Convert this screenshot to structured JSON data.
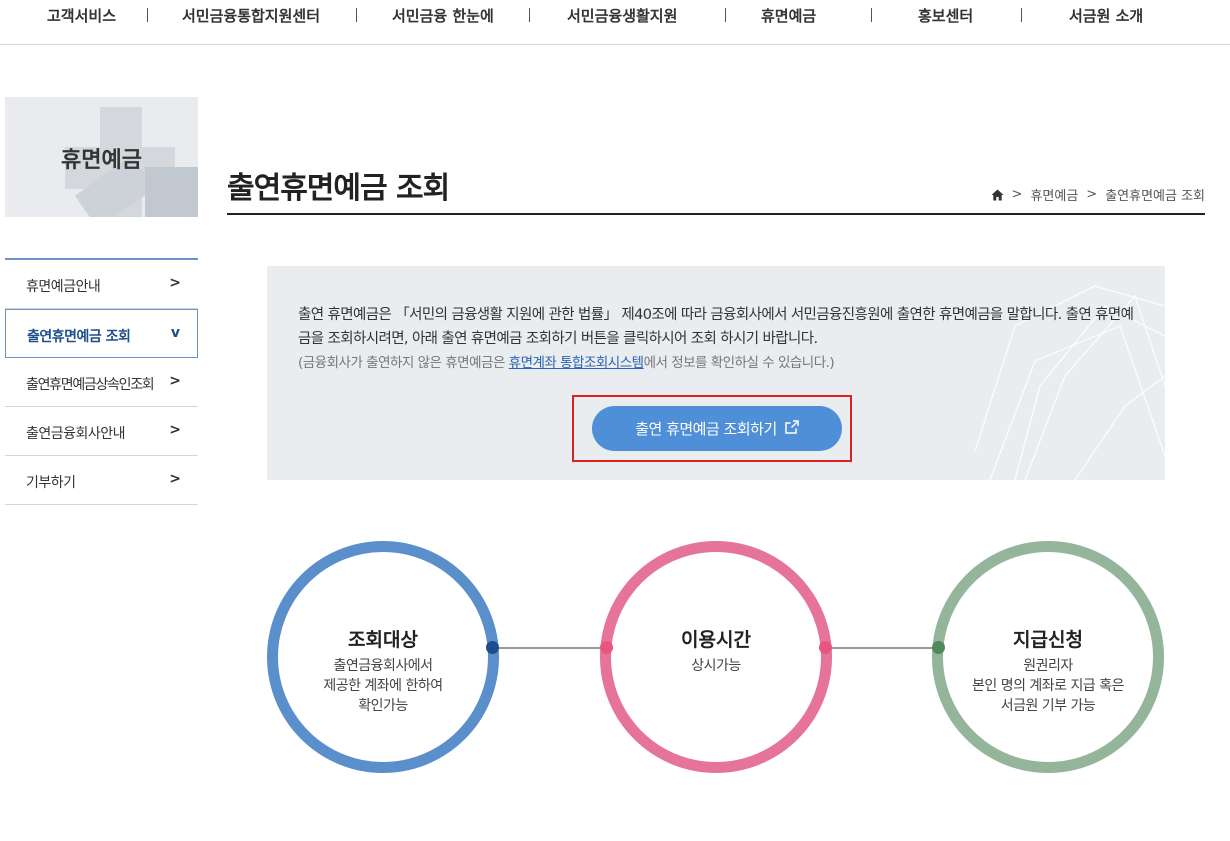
{
  "topnav": {
    "items": [
      "고객서비스",
      "서민금융통합지원센터",
      "서민금융 한눈에",
      "서민금융생활지원",
      "휴면예금",
      "홍보센터",
      "서금원 소개"
    ]
  },
  "sidebar": {
    "title": "휴면예금",
    "items": [
      {
        "label": "휴면예금안내",
        "arrow": ">"
      },
      {
        "label": "출연휴면예금 조회",
        "arrow": "v"
      },
      {
        "label": "출연휴면예금상속인조회",
        "arrow": ">"
      },
      {
        "label": "출연금융회사안내",
        "arrow": ">"
      },
      {
        "label": "기부하기",
        "arrow": ">"
      }
    ]
  },
  "page": {
    "title": "출연휴면예금 조회",
    "breadcrumb": [
      ">",
      "휴면예금",
      ">",
      "출연휴면예금 조회"
    ]
  },
  "info": {
    "text": "출연 휴면예금은 「서민의 금융생활 지원에 관한 법률」 제40조에 따라 금융회사에서 서민금융진흥원에 출연한 휴면예금을 말합니다. 출연 휴면예금을 조회하시려면, 아래 출연 휴면예금 조회하기 버튼을 클릭하시어 조회 하시기 바랍니다.",
    "sub_prefix": "(금융회사가 출연하지 않은 휴면예금은 ",
    "sub_link": "휴면계좌 통합조회시스템",
    "sub_suffix": "에서 정보를 확인하실 수 있습니다.)",
    "button_label": "출연 휴면예금 조회하기"
  },
  "circles": [
    {
      "title": "조회대상",
      "lines": [
        "출연금융회사에서",
        "제공한 계좌에 한하여",
        "확인가능"
      ],
      "color": "#5a8fcb",
      "dot": "#1e4d8c"
    },
    {
      "title": "이용시간",
      "lines": [
        "상시가능"
      ],
      "color": "#e5739a",
      "dot": "#e8557f"
    },
    {
      "title": "지급신청",
      "lines": [
        "원권리자",
        "본인 명의 계좌로 지급 혹은",
        "서금원 기부 가능"
      ],
      "color": "#94b59a",
      "dot": "#4f8a5a"
    }
  ],
  "icons": {
    "home": "home-icon",
    "external": "external-link-icon"
  },
  "colors": {
    "accent": "#4f8fd8",
    "highlight": "#e0201d",
    "menu_border": "#6b94c4"
  }
}
